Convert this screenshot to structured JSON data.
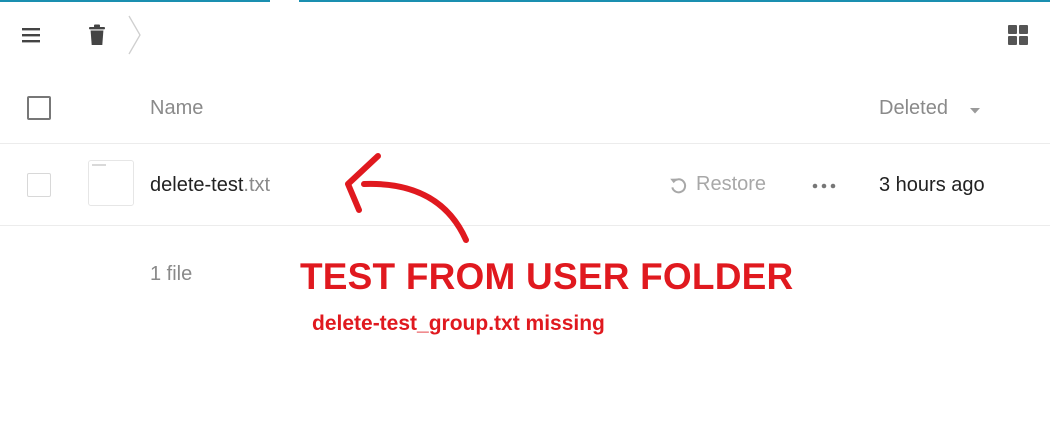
{
  "toolbar": {
    "menu_icon": "hamburger-menu-icon",
    "breadcrumb_icon": "trash-icon",
    "view_toggle_icon": "grid-view-icon"
  },
  "table": {
    "columns": {
      "name": "Name",
      "deleted": "Deleted"
    },
    "sort_icon": "caret-down-icon",
    "rows": [
      {
        "name": "delete-test",
        "extension": ".txt",
        "restore_label": "Restore",
        "deleted": "3 hours ago"
      }
    ],
    "summary": "1 file"
  },
  "annotation": {
    "title": "TEST FROM USER FOLDER",
    "subtitle": "delete-test_group.txt missing",
    "color": "#e0191f"
  },
  "colors": {
    "accent": "#1a8fb0",
    "muted_text": "#8a8a8a"
  }
}
